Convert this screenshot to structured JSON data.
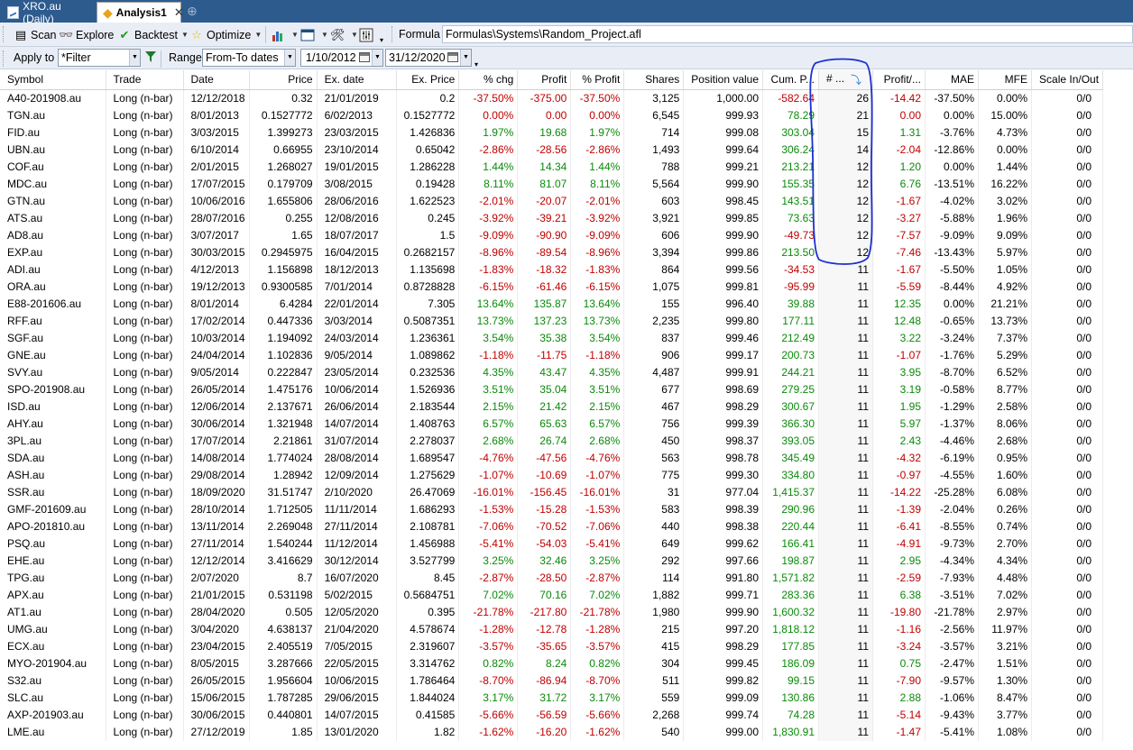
{
  "tabs": [
    {
      "label": "XRO.au (Daily)",
      "active": false,
      "icon": "chart-icon"
    },
    {
      "label": "Analysis1",
      "active": true,
      "icon": "analysis-icon"
    }
  ],
  "toolbar": {
    "scan_label": "Scan",
    "explore_label": "Explore",
    "backtest_label": "Backtest",
    "optimize_label": "Optimize",
    "formula_label": "Formula",
    "formula_path": "Formulas\\Systems\\Random_Project.afl"
  },
  "filterbar": {
    "apply_to_label": "Apply to",
    "apply_to_value": "*Filter",
    "range_label": "Range",
    "range_value": "From-To dates",
    "from_date": "1/10/2012",
    "to_date": "31/12/2020"
  },
  "columns": [
    "Symbol",
    "Trade",
    "Date",
    "Price",
    "Ex. date",
    "Ex. Price",
    "% chg",
    "Profit",
    "% Profit",
    "Shares",
    "Position value",
    "Cum. P...",
    "# ...",
    "Profit/...",
    "MAE",
    "MFE",
    "Scale In/Out"
  ],
  "colors": {
    "positive": "#0a8a0a",
    "negative": "#c00000",
    "annotation": "#1a2fd0",
    "tabbar": "#2d5b8e"
  },
  "rows": [
    [
      "A40-201908.au",
      "Long (n-bar)",
      "12/12/2018",
      "0.32",
      "21/01/2019",
      "0.2",
      "-37.50%",
      "-375.00",
      "-37.50%",
      "3,125",
      "1,000.00",
      "-582.64",
      "26",
      "-14.42",
      "-37.50%",
      "0.00%",
      "0/0"
    ],
    [
      "TGN.au",
      "Long (n-bar)",
      "8/01/2013",
      "0.1527772",
      "6/02/2013",
      "0.1527772",
      "0.00%",
      "0.00",
      "0.00%",
      "6,545",
      "999.93",
      "78.29",
      "21",
      "0.00",
      "0.00%",
      "15.00%",
      "0/0"
    ],
    [
      "FID.au",
      "Long (n-bar)",
      "3/03/2015",
      "1.399273",
      "23/03/2015",
      "1.426836",
      "1.97%",
      "19.68",
      "1.97%",
      "714",
      "999.08",
      "303.04",
      "15",
      "1.31",
      "-3.76%",
      "4.73%",
      "0/0"
    ],
    [
      "UBN.au",
      "Long (n-bar)",
      "6/10/2014",
      "0.66955",
      "23/10/2014",
      "0.65042",
      "-2.86%",
      "-28.56",
      "-2.86%",
      "1,493",
      "999.64",
      "306.24",
      "14",
      "-2.04",
      "-12.86%",
      "0.00%",
      "0/0"
    ],
    [
      "COF.au",
      "Long (n-bar)",
      "2/01/2015",
      "1.268027",
      "19/01/2015",
      "1.286228",
      "1.44%",
      "14.34",
      "1.44%",
      "788",
      "999.21",
      "213.21",
      "12",
      "1.20",
      "0.00%",
      "1.44%",
      "0/0"
    ],
    [
      "MDC.au",
      "Long (n-bar)",
      "17/07/2015",
      "0.179709",
      "3/08/2015",
      "0.19428",
      "8.11%",
      "81.07",
      "8.11%",
      "5,564",
      "999.90",
      "155.35",
      "12",
      "6.76",
      "-13.51%",
      "16.22%",
      "0/0"
    ],
    [
      "GTN.au",
      "Long (n-bar)",
      "10/06/2016",
      "1.655806",
      "28/06/2016",
      "1.622523",
      "-2.01%",
      "-20.07",
      "-2.01%",
      "603",
      "998.45",
      "143.51",
      "12",
      "-1.67",
      "-4.02%",
      "3.02%",
      "0/0"
    ],
    [
      "ATS.au",
      "Long (n-bar)",
      "28/07/2016",
      "0.255",
      "12/08/2016",
      "0.245",
      "-3.92%",
      "-39.21",
      "-3.92%",
      "3,921",
      "999.85",
      "73.63",
      "12",
      "-3.27",
      "-5.88%",
      "1.96%",
      "0/0"
    ],
    [
      "AD8.au",
      "Long (n-bar)",
      "3/07/2017",
      "1.65",
      "18/07/2017",
      "1.5",
      "-9.09%",
      "-90.90",
      "-9.09%",
      "606",
      "999.90",
      "-49.73",
      "12",
      "-7.57",
      "-9.09%",
      "9.09%",
      "0/0"
    ],
    [
      "EXP.au",
      "Long (n-bar)",
      "30/03/2015",
      "0.2945975",
      "16/04/2015",
      "0.2682157",
      "-8.96%",
      "-89.54",
      "-8.96%",
      "3,394",
      "999.86",
      "213.50",
      "12",
      "-7.46",
      "-13.43%",
      "5.97%",
      "0/0"
    ],
    [
      "ADI.au",
      "Long (n-bar)",
      "4/12/2013",
      "1.156898",
      "18/12/2013",
      "1.135698",
      "-1.83%",
      "-18.32",
      "-1.83%",
      "864",
      "999.56",
      "-34.53",
      "11",
      "-1.67",
      "-5.50%",
      "1.05%",
      "0/0"
    ],
    [
      "ORA.au",
      "Long (n-bar)",
      "19/12/2013",
      "0.9300585",
      "7/01/2014",
      "0.8728828",
      "-6.15%",
      "-61.46",
      "-6.15%",
      "1,075",
      "999.81",
      "-95.99",
      "11",
      "-5.59",
      "-8.44%",
      "4.92%",
      "0/0"
    ],
    [
      "E88-201606.au",
      "Long (n-bar)",
      "8/01/2014",
      "6.4284",
      "22/01/2014",
      "7.305",
      "13.64%",
      "135.87",
      "13.64%",
      "155",
      "996.40",
      "39.88",
      "11",
      "12.35",
      "0.00%",
      "21.21%",
      "0/0"
    ],
    [
      "RFF.au",
      "Long (n-bar)",
      "17/02/2014",
      "0.447336",
      "3/03/2014",
      "0.5087351",
      "13.73%",
      "137.23",
      "13.73%",
      "2,235",
      "999.80",
      "177.11",
      "11",
      "12.48",
      "-0.65%",
      "13.73%",
      "0/0"
    ],
    [
      "SGF.au",
      "Long (n-bar)",
      "10/03/2014",
      "1.194092",
      "24/03/2014",
      "1.236361",
      "3.54%",
      "35.38",
      "3.54%",
      "837",
      "999.46",
      "212.49",
      "11",
      "3.22",
      "-3.24%",
      "7.37%",
      "0/0"
    ],
    [
      "GNE.au",
      "Long (n-bar)",
      "24/04/2014",
      "1.102836",
      "9/05/2014",
      "1.089862",
      "-1.18%",
      "-11.75",
      "-1.18%",
      "906",
      "999.17",
      "200.73",
      "11",
      "-1.07",
      "-1.76%",
      "5.29%",
      "0/0"
    ],
    [
      "SVY.au",
      "Long (n-bar)",
      "9/05/2014",
      "0.222847",
      "23/05/2014",
      "0.232536",
      "4.35%",
      "43.47",
      "4.35%",
      "4,487",
      "999.91",
      "244.21",
      "11",
      "3.95",
      "-8.70%",
      "6.52%",
      "0/0"
    ],
    [
      "SPO-201908.au",
      "Long (n-bar)",
      "26/05/2014",
      "1.475176",
      "10/06/2014",
      "1.526936",
      "3.51%",
      "35.04",
      "3.51%",
      "677",
      "998.69",
      "279.25",
      "11",
      "3.19",
      "-0.58%",
      "8.77%",
      "0/0"
    ],
    [
      "ISD.au",
      "Long (n-bar)",
      "12/06/2014",
      "2.137671",
      "26/06/2014",
      "2.183544",
      "2.15%",
      "21.42",
      "2.15%",
      "467",
      "998.29",
      "300.67",
      "11",
      "1.95",
      "-1.29%",
      "2.58%",
      "0/0"
    ],
    [
      "AHY.au",
      "Long (n-bar)",
      "30/06/2014",
      "1.321948",
      "14/07/2014",
      "1.408763",
      "6.57%",
      "65.63",
      "6.57%",
      "756",
      "999.39",
      "366.30",
      "11",
      "5.97",
      "-1.37%",
      "8.06%",
      "0/0"
    ],
    [
      "3PL.au",
      "Long (n-bar)",
      "17/07/2014",
      "2.21861",
      "31/07/2014",
      "2.278037",
      "2.68%",
      "26.74",
      "2.68%",
      "450",
      "998.37",
      "393.05",
      "11",
      "2.43",
      "-4.46%",
      "2.68%",
      "0/0"
    ],
    [
      "SDA.au",
      "Long (n-bar)",
      "14/08/2014",
      "1.774024",
      "28/08/2014",
      "1.689547",
      "-4.76%",
      "-47.56",
      "-4.76%",
      "563",
      "998.78",
      "345.49",
      "11",
      "-4.32",
      "-6.19%",
      "0.95%",
      "0/0"
    ],
    [
      "ASH.au",
      "Long (n-bar)",
      "29/08/2014",
      "1.28942",
      "12/09/2014",
      "1.275629",
      "-1.07%",
      "-10.69",
      "-1.07%",
      "775",
      "999.30",
      "334.80",
      "11",
      "-0.97",
      "-4.55%",
      "1.60%",
      "0/0"
    ],
    [
      "SSR.au",
      "Long (n-bar)",
      "18/09/2020",
      "31.51747",
      "2/10/2020",
      "26.47069",
      "-16.01%",
      "-156.45",
      "-16.01%",
      "31",
      "977.04",
      "1,415.37",
      "11",
      "-14.22",
      "-25.28%",
      "6.08%",
      "0/0"
    ],
    [
      "GMF-201609.au",
      "Long (n-bar)",
      "28/10/2014",
      "1.712505",
      "11/11/2014",
      "1.686293",
      "-1.53%",
      "-15.28",
      "-1.53%",
      "583",
      "998.39",
      "290.96",
      "11",
      "-1.39",
      "-2.04%",
      "0.26%",
      "0/0"
    ],
    [
      "APO-201810.au",
      "Long (n-bar)",
      "13/11/2014",
      "2.269048",
      "27/11/2014",
      "2.108781",
      "-7.06%",
      "-70.52",
      "-7.06%",
      "440",
      "998.38",
      "220.44",
      "11",
      "-6.41",
      "-8.55%",
      "0.74%",
      "0/0"
    ],
    [
      "PSQ.au",
      "Long (n-bar)",
      "27/11/2014",
      "1.540244",
      "11/12/2014",
      "1.456988",
      "-5.41%",
      "-54.03",
      "-5.41%",
      "649",
      "999.62",
      "166.41",
      "11",
      "-4.91",
      "-9.73%",
      "2.70%",
      "0/0"
    ],
    [
      "EHE.au",
      "Long (n-bar)",
      "12/12/2014",
      "3.416629",
      "30/12/2014",
      "3.527799",
      "3.25%",
      "32.46",
      "3.25%",
      "292",
      "997.66",
      "198.87",
      "11",
      "2.95",
      "-4.34%",
      "4.34%",
      "0/0"
    ],
    [
      "TPG.au",
      "Long (n-bar)",
      "2/07/2020",
      "8.7",
      "16/07/2020",
      "8.45",
      "-2.87%",
      "-28.50",
      "-2.87%",
      "114",
      "991.80",
      "1,571.82",
      "11",
      "-2.59",
      "-7.93%",
      "4.48%",
      "0/0"
    ],
    [
      "APX.au",
      "Long (n-bar)",
      "21/01/2015",
      "0.531198",
      "5/02/2015",
      "0.5684751",
      "7.02%",
      "70.16",
      "7.02%",
      "1,882",
      "999.71",
      "283.36",
      "11",
      "6.38",
      "-3.51%",
      "7.02%",
      "0/0"
    ],
    [
      "AT1.au",
      "Long (n-bar)",
      "28/04/2020",
      "0.505",
      "12/05/2020",
      "0.395",
      "-21.78%",
      "-217.80",
      "-21.78%",
      "1,980",
      "999.90",
      "1,600.32",
      "11",
      "-19.80",
      "-21.78%",
      "2.97%",
      "0/0"
    ],
    [
      "UMG.au",
      "Long (n-bar)",
      "3/04/2020",
      "4.638137",
      "21/04/2020",
      "4.578674",
      "-1.28%",
      "-12.78",
      "-1.28%",
      "215",
      "997.20",
      "1,818.12",
      "11",
      "-1.16",
      "-2.56%",
      "11.97%",
      "0/0"
    ],
    [
      "ECX.au",
      "Long (n-bar)",
      "23/04/2015",
      "2.405519",
      "7/05/2015",
      "2.319607",
      "-3.57%",
      "-35.65",
      "-3.57%",
      "415",
      "998.29",
      "177.85",
      "11",
      "-3.24",
      "-3.57%",
      "3.21%",
      "0/0"
    ],
    [
      "MYO-201904.au",
      "Long (n-bar)",
      "8/05/2015",
      "3.287666",
      "22/05/2015",
      "3.314762",
      "0.82%",
      "8.24",
      "0.82%",
      "304",
      "999.45",
      "186.09",
      "11",
      "0.75",
      "-2.47%",
      "1.51%",
      "0/0"
    ],
    [
      "S32.au",
      "Long (n-bar)",
      "26/05/2015",
      "1.956604",
      "10/06/2015",
      "1.786464",
      "-8.70%",
      "-86.94",
      "-8.70%",
      "511",
      "999.82",
      "99.15",
      "11",
      "-7.90",
      "-9.57%",
      "1.30%",
      "0/0"
    ],
    [
      "SLC.au",
      "Long (n-bar)",
      "15/06/2015",
      "1.787285",
      "29/06/2015",
      "1.844024",
      "3.17%",
      "31.72",
      "3.17%",
      "559",
      "999.09",
      "130.86",
      "11",
      "2.88",
      "-1.06%",
      "8.47%",
      "0/0"
    ],
    [
      "AXP-201903.au",
      "Long (n-bar)",
      "30/06/2015",
      "0.440801",
      "14/07/2015",
      "0.41585",
      "-5.66%",
      "-56.59",
      "-5.66%",
      "2,268",
      "999.74",
      "74.28",
      "11",
      "-5.14",
      "-9.43%",
      "3.77%",
      "0/0"
    ],
    [
      "LME.au",
      "Long (n-bar)",
      "27/12/2019",
      "1.85",
      "13/01/2020",
      "1.82",
      "-1.62%",
      "-16.20",
      "-1.62%",
      "540",
      "999.00",
      "1,830.91",
      "11",
      "-1.47",
      "-5.41%",
      "1.08%",
      "0/0"
    ]
  ]
}
